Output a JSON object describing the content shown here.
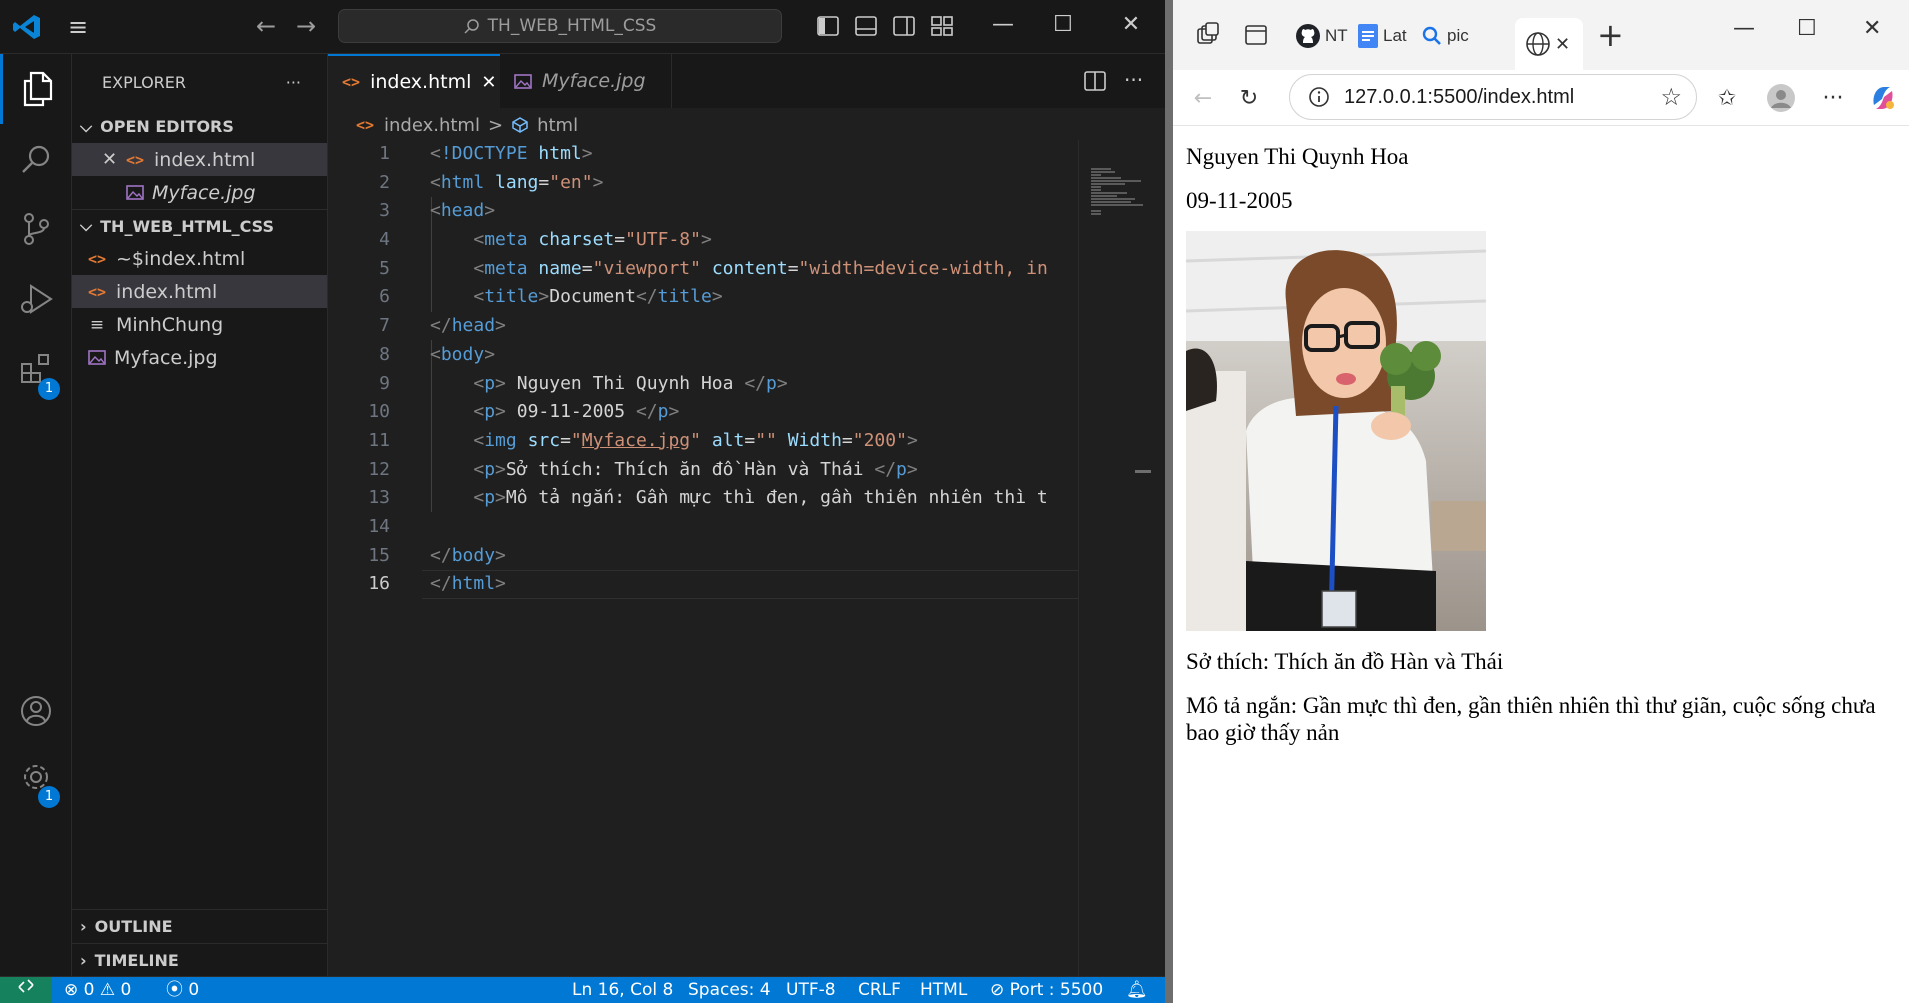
{
  "vscode": {
    "command_center": "TH_WEB_HTML_CSS",
    "activity_badge_extensions": "1",
    "activity_badge_settings": "1",
    "explorer": {
      "title": "EXPLORER",
      "more": "···",
      "open_editors_title": "OPEN EDITORS",
      "open_editors": [
        {
          "name": "index.html",
          "icon": "html-file-icon"
        },
        {
          "name": "Myface.jpg",
          "icon": "image-file-icon"
        }
      ],
      "folder_title": "TH_WEB_HTML_CSS",
      "files": [
        {
          "name": "~$index.html",
          "icon": "html-file-icon"
        },
        {
          "name": "index.html",
          "icon": "html-file-icon"
        },
        {
          "name": "MinhChung",
          "icon": "text-file-icon"
        },
        {
          "name": "Myface.jpg",
          "icon": "image-file-icon"
        }
      ],
      "outline_title": "OUTLINE",
      "timeline_title": "TIMELINE"
    },
    "tabs": [
      {
        "name": "index.html",
        "active": true
      },
      {
        "name": "Myface.jpg",
        "active": false
      }
    ],
    "breadcrumb": {
      "file": "index.html",
      "sep": ">",
      "symbol": "html"
    },
    "line_numbers": [
      "1",
      "2",
      "3",
      "4",
      "5",
      "6",
      "7",
      "8",
      "9",
      "10",
      "11",
      "12",
      "13",
      "14",
      "15",
      "16"
    ],
    "code": {
      "l1_doctype": "!DOCTYPE",
      "l1_html": "html",
      "l2_tag": "html",
      "l2_attr": "lang",
      "l2_val": "\"en\"",
      "l3_tag": "head",
      "l4_tag": "meta",
      "l4_attr": "charset",
      "l4_val": "\"UTF-8\"",
      "l5_tag": "meta",
      "l5_attr1": "name",
      "l5_val1": "\"viewport\"",
      "l5_attr2": "content",
      "l5_val2": "\"width=device-width, in",
      "l6_tag": "title",
      "l6_text": "Document",
      "l7_tag": "head",
      "l8_tag": "body",
      "l9_tag": "p",
      "l9_text": " Nguyen Thi Quynh Hoa ",
      "l10_tag": "p",
      "l10_text": " 09-11-2005 ",
      "l11_tag": "img",
      "l11_attr1": "src",
      "l11_val1": "Myface.jpg",
      "l11_attr2": "alt",
      "l11_val2": "\"\"",
      "l11_attr3": "Width",
      "l11_val3": "\"200\"",
      "l12_tag": "p",
      "l12_text": "Sở thích: Thích ăn đồ Hàn và Thái ",
      "l13_tag": "p",
      "l13_text": "Mô tả ngắn: Gần mực thì đen, gần thiên nhiên thì t",
      "l15_tag": "body",
      "l16_tag": "html"
    },
    "status": {
      "problems_errors": "0",
      "problems_warnings": "0",
      "ports": "0",
      "position": "Ln 16, Col 8",
      "spaces": "Spaces: 4",
      "encoding": "UTF-8",
      "eol": "CRLF",
      "language": "HTML",
      "port": "Port : 5500"
    }
  },
  "browser": {
    "tabs": [
      {
        "label": "NT",
        "icon": "github-icon"
      },
      {
        "label": "Lat",
        "icon": "docs-icon"
      },
      {
        "label": "pic",
        "icon": "search-icon"
      }
    ],
    "url": "127.0.0.1:5500/index.html",
    "page": {
      "name": "Nguyen Thi Quynh Hoa",
      "dob": "09-11-2005",
      "hobby": "Sở thích: Thích ăn đồ Hàn và Thái",
      "description": "Mô tả ngắn: Gần mực thì đen, gần thiên nhiên thì thư giãn, cuộc sống chưa bao giờ thấy nản"
    }
  },
  "colors": {
    "accent": "#0078d4",
    "status_bar": "#0078d4",
    "remote": "#16825d",
    "html_icon": "#e37933"
  }
}
